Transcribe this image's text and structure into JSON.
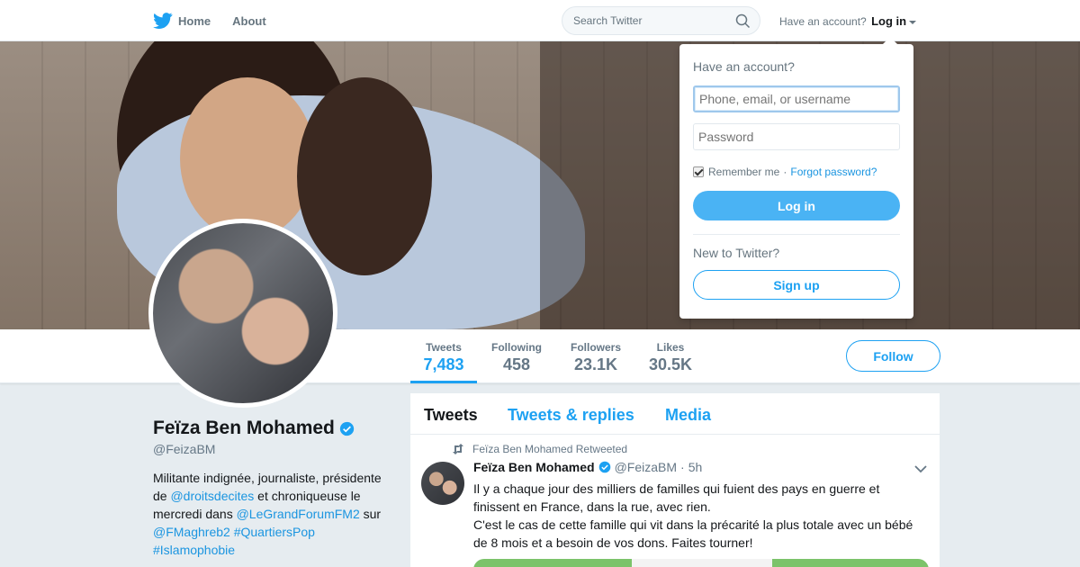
{
  "nav": {
    "home_label": "Home",
    "about_label": "About",
    "search_placeholder": "Search Twitter",
    "have_account_text": "Have an account?",
    "login_label": "Log in"
  },
  "colors": {
    "brand": "#1da1f2",
    "link": "#1b95e0",
    "login_button": "#4ab3f4"
  },
  "profile": {
    "name": "Feïza Ben Mohamed",
    "handle": "@FeizaBM",
    "bio": {
      "p1": "Militante indignée, journaliste, présidente de ",
      "m1": "@droitsdecites",
      "p2": " et chroniqueuse le mercredi dans ",
      "m2": "@LeGrandForumFM2",
      "p3": " sur ",
      "m3": "@FMaghreb2",
      "h1": "#QuartiersPop",
      "h2": "#Islamophobie"
    }
  },
  "stats": [
    {
      "label": "Tweets",
      "value": "7,483"
    },
    {
      "label": "Following",
      "value": "458"
    },
    {
      "label": "Followers",
      "value": "23.1K"
    },
    {
      "label": "Likes",
      "value": "30.5K"
    }
  ],
  "follow_label": "Follow",
  "timeline": {
    "tabs": [
      "Tweets",
      "Tweets & replies",
      "Media"
    ],
    "tweet": {
      "retweet_context": "Feïza Ben Mohamed Retweeted",
      "author_name": "Feïza Ben Mohamed",
      "author_handle": "@FeizaBM",
      "separator": "·",
      "time": "5h",
      "text_line1": "Il y a chaque jour des milliers de familles qui fuient des pays en guerre et finissent en France, dans la rue, avec rien.",
      "text_line2": "C'est le cas de cette famille qui vit dans la précarité la plus totale avec un bébé de 8 mois et a besoin de vos dons. Faites tourner!"
    }
  },
  "login_dropdown": {
    "title": "Have an account?",
    "username_placeholder": "Phone, email, or username",
    "password_placeholder": "Password",
    "remember_label": "Remember me",
    "separator": "·",
    "forgot_label": "Forgot password?",
    "login_button": "Log in",
    "new_text": "New to Twitter?",
    "signup_button": "Sign up"
  }
}
